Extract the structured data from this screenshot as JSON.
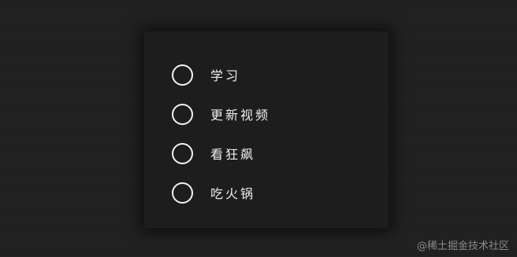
{
  "todos": [
    {
      "label": "学习",
      "checked": false
    },
    {
      "label": "更新视频",
      "checked": false
    },
    {
      "label": "看狂飙",
      "checked": false
    },
    {
      "label": "吃火锅",
      "checked": false
    }
  ],
  "watermark": "@稀土掘金技术社区"
}
